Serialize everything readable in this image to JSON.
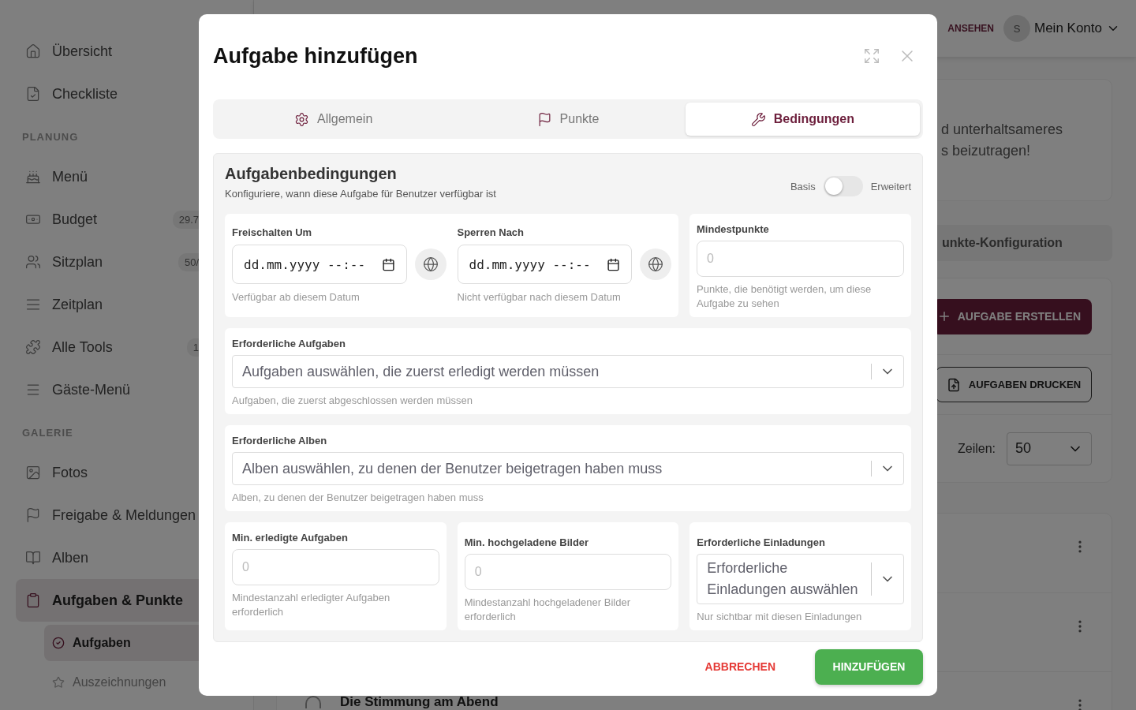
{
  "sidebar": {
    "sections": [
      {
        "items": [
          {
            "label": "Übersicht",
            "selected": false
          },
          {
            "label": "Checkliste",
            "selected": false
          }
        ]
      },
      {
        "heading": "PLANUNG",
        "items": [
          {
            "label": "Menü",
            "selected": false
          },
          {
            "label": "Budget",
            "badge": "29.7",
            "selected": false
          },
          {
            "label": "Sitzplan",
            "badge": "50/",
            "selected": false
          },
          {
            "label": "Zeitplan",
            "selected": false
          },
          {
            "label": "Alle Tools",
            "badge": "1",
            "selected": false
          },
          {
            "label": "Gäste-Menü",
            "selected": false
          }
        ]
      },
      {
        "heading": "GALERIE",
        "items": [
          {
            "label": "Fotos",
            "selected": false
          },
          {
            "label": "Freigabe & Meldungen",
            "selected": false
          },
          {
            "label": "Alben",
            "selected": false
          },
          {
            "label": "Aufgaben & Punkte",
            "selected": true,
            "expanded": true,
            "children": [
              {
                "label": "Aufgaben",
                "selected": true
              },
              {
                "label": "Auszeichnungen",
                "selected": false
              }
            ]
          }
        ]
      }
    ]
  },
  "topbar": {
    "link": "ANSEHEN",
    "avatar": "S",
    "account": "Mein Konto"
  },
  "background": {
    "intro_lines": [
      "d unterhaltsameres",
      "s beizutragen!"
    ],
    "config_bar": "unkte-Konfiguration",
    "create_button": "AUFGABE ERSTELLEN",
    "print_button": "AUFGABEN DRUCKEN",
    "rows_label": "Zeilen:",
    "rows_value": "50",
    "list_rows": [
      {},
      {},
      {
        "title": "Die Stimmung am Abend",
        "checked": false
      }
    ]
  },
  "dialog": {
    "title": "Aufgabe hinzufügen",
    "tabs": [
      {
        "label": "Allgemein",
        "selected": false
      },
      {
        "label": "Punkte",
        "selected": false
      },
      {
        "label": "Bedingungen",
        "selected": true
      }
    ],
    "section": {
      "title": "Aufgabenbedingungen",
      "subtitle": "Konfiguriere, wann diese Aufgabe für Benutzer verfügbar ist",
      "toggle": {
        "left": "Basis",
        "right": "Erweitert",
        "on": false
      }
    },
    "date_fields": [
      {
        "label": "Freischalten Um",
        "placeholder": "dd.mm.yyyy --:--",
        "hint": "Verfügbar ab diesem Datum"
      },
      {
        "label": "Sperren Nach",
        "placeholder": "dd.mm.yyyy --:--",
        "hint": "Nicht verfügbar nach diesem Datum"
      }
    ],
    "min_points": {
      "label": "Mindestpunkte",
      "placeholder": "0",
      "hint": "Punkte, die benötigt werden, um diese Aufgabe zu sehen"
    },
    "selects": [
      {
        "label": "Erforderliche Aufgaben",
        "placeholder": "Aufgaben auswählen, die zuerst erledigt werden müssen",
        "hint": "Aufgaben, die zuerst abgeschlossen werden müssen"
      },
      {
        "label": "Erforderliche Alben",
        "placeholder": "Alben auswählen, zu denen der Benutzer beigetragen haben muss",
        "hint": "Alben, zu denen der Benutzer beigetragen haben muss"
      }
    ],
    "bottom_fields": [
      {
        "kind": "number",
        "label": "Min. erledigte Aufgaben",
        "placeholder": "0",
        "hint": "Mindestanzahl erledigter Aufgaben erforderlich"
      },
      {
        "kind": "number",
        "label": "Min. hochgeladene Bilder",
        "placeholder": "0",
        "hint": "Mindestanzahl hochgeladener Bilder erforderlich"
      },
      {
        "kind": "select",
        "label": "Erforderliche Einladungen",
        "placeholder": "Erforderliche Einladungen auswählen",
        "hint": "Nur sichtbar mit diesen Einladungen"
      }
    ],
    "buttons": {
      "cancel": "ABBRECHEN",
      "submit": "HINZUFÜGEN"
    }
  }
}
